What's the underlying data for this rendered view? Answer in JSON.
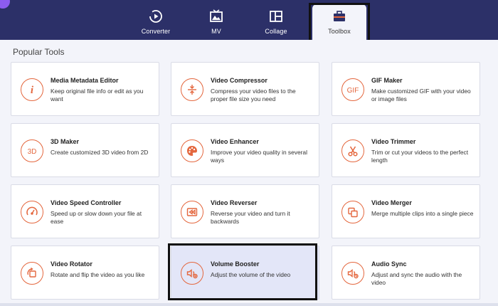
{
  "colors": {
    "nav_bg": "#2c3068",
    "accent": "#e4673e",
    "content_bg": "#f3f4fa"
  },
  "nav": {
    "tabs": [
      {
        "label": "Converter",
        "icon": "converter-icon",
        "active": false
      },
      {
        "label": "MV",
        "icon": "mv-icon",
        "active": false
      },
      {
        "label": "Collage",
        "icon": "collage-icon",
        "active": false
      },
      {
        "label": "Toolbox",
        "icon": "toolbox-icon",
        "active": true
      }
    ]
  },
  "main": {
    "section_title": "Popular Tools",
    "tools": [
      {
        "title": "Media Metadata Editor",
        "desc": "Keep original file info or edit as you want",
        "icon": "info-icon"
      },
      {
        "title": "Video Compressor",
        "desc": "Compress your video files to the proper file size you need",
        "icon": "compress-icon"
      },
      {
        "title": "GIF Maker",
        "desc": "Make customized GIF with your video or image files",
        "icon": "gif-icon"
      },
      {
        "title": "3D Maker",
        "desc": "Create customized 3D video from 2D",
        "icon": "3d-icon"
      },
      {
        "title": "Video Enhancer",
        "desc": "Improve your video quality in several ways",
        "icon": "palette-icon"
      },
      {
        "title": "Video Trimmer",
        "desc": "Trim or cut your videos to the perfect length",
        "icon": "scissors-icon"
      },
      {
        "title": "Video Speed Controller",
        "desc": "Speed up or slow down your file at ease",
        "icon": "speedometer-icon"
      },
      {
        "title": "Video Reverser",
        "desc": "Reverse your video and turn it backwards",
        "icon": "rewind-icon"
      },
      {
        "title": "Video Merger",
        "desc": "Merge multiple clips into a single piece",
        "icon": "merge-icon"
      },
      {
        "title": "Video Rotator",
        "desc": "Rotate and flip the video as you like",
        "icon": "rotate-icon"
      },
      {
        "title": "Volume Booster",
        "desc": "Adjust the volume of the video",
        "icon": "volume-icon",
        "selected": true
      },
      {
        "title": "Audio Sync",
        "desc": "Adjust and sync the audio with the video",
        "icon": "audio-sync-icon"
      }
    ]
  }
}
